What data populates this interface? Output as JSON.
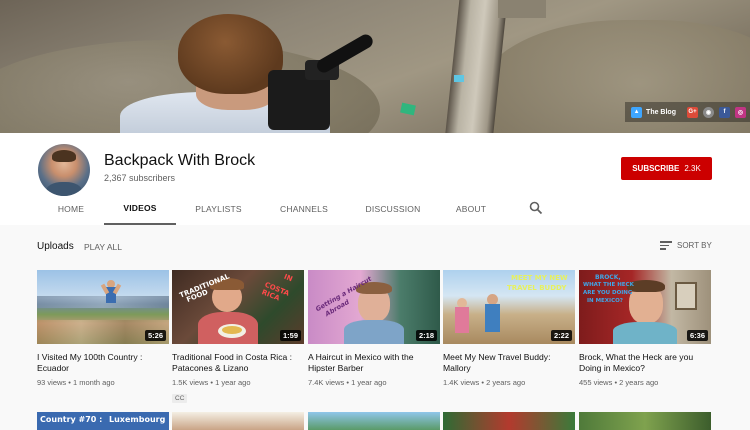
{
  "banner": {
    "links": [
      {
        "name": "blog",
        "label": "The Blog",
        "color": "#3ea6ff"
      },
      {
        "name": "google-plus",
        "label": "G+",
        "color": "#dd4b39"
      },
      {
        "name": "website",
        "label": "",
        "color": "#8a8a8a"
      },
      {
        "name": "facebook",
        "label": "f",
        "color": "#3b5998"
      },
      {
        "name": "instagram",
        "label": "",
        "color": "#c13584"
      }
    ]
  },
  "channel": {
    "name": "Backpack With Brock",
    "subscribers": "2,367 subscribers",
    "subscribe_label": "SUBSCRIBE",
    "subscribe_count": "2.3K",
    "accent": "#cc0000"
  },
  "tabs": [
    {
      "label": "HOME",
      "active": false
    },
    {
      "label": "VIDEOS",
      "active": true
    },
    {
      "label": "PLAYLISTS",
      "active": false
    },
    {
      "label": "CHANNELS",
      "active": false
    },
    {
      "label": "DISCUSSION",
      "active": false
    },
    {
      "label": "ABOUT",
      "active": false
    }
  ],
  "section": {
    "title": "Uploads",
    "play_all": "PLAY ALL",
    "sort_by": "SORT BY"
  },
  "videos": [
    {
      "title": "I Visited My 100th Country : Ecuador",
      "views": "93 views",
      "age": "1 month ago",
      "duration": "5:26",
      "cc": ""
    },
    {
      "title": "Traditional Food in Costa Rica : Patacones & Lizano",
      "views": "1.5K views",
      "age": "1 year ago",
      "duration": "1:59",
      "cc": "CC",
      "thumb_text": [
        "TRADITIONAL",
        "FOOD",
        "IN",
        "COSTA RICA"
      ]
    },
    {
      "title": "A Haircut in Mexico with the Hipster Barber",
      "views": "7.4K views",
      "age": "1 year ago",
      "duration": "2:18",
      "cc": "",
      "thumb_text": [
        "Getting a Haircut",
        "Abroad"
      ]
    },
    {
      "title": "Meet My New Travel Buddy: Mallory",
      "views": "1.4K views",
      "age": "2 years ago",
      "duration": "2:22",
      "cc": "",
      "thumb_text": [
        "MEET MY NEW",
        "TRAVEL BUDDY"
      ]
    },
    {
      "title": "Brock, What the Heck are you Doing in Mexico?",
      "views": "455 views",
      "age": "2 years ago",
      "duration": "6:36",
      "cc": "",
      "thumb_text": [
        "BROCK,",
        "WHAT THE HECK",
        "ARE YOU DOING",
        "IN MEXICO?"
      ]
    }
  ],
  "row2_thumb_text": [
    "Country #70 :",
    "Luxembourg"
  ]
}
